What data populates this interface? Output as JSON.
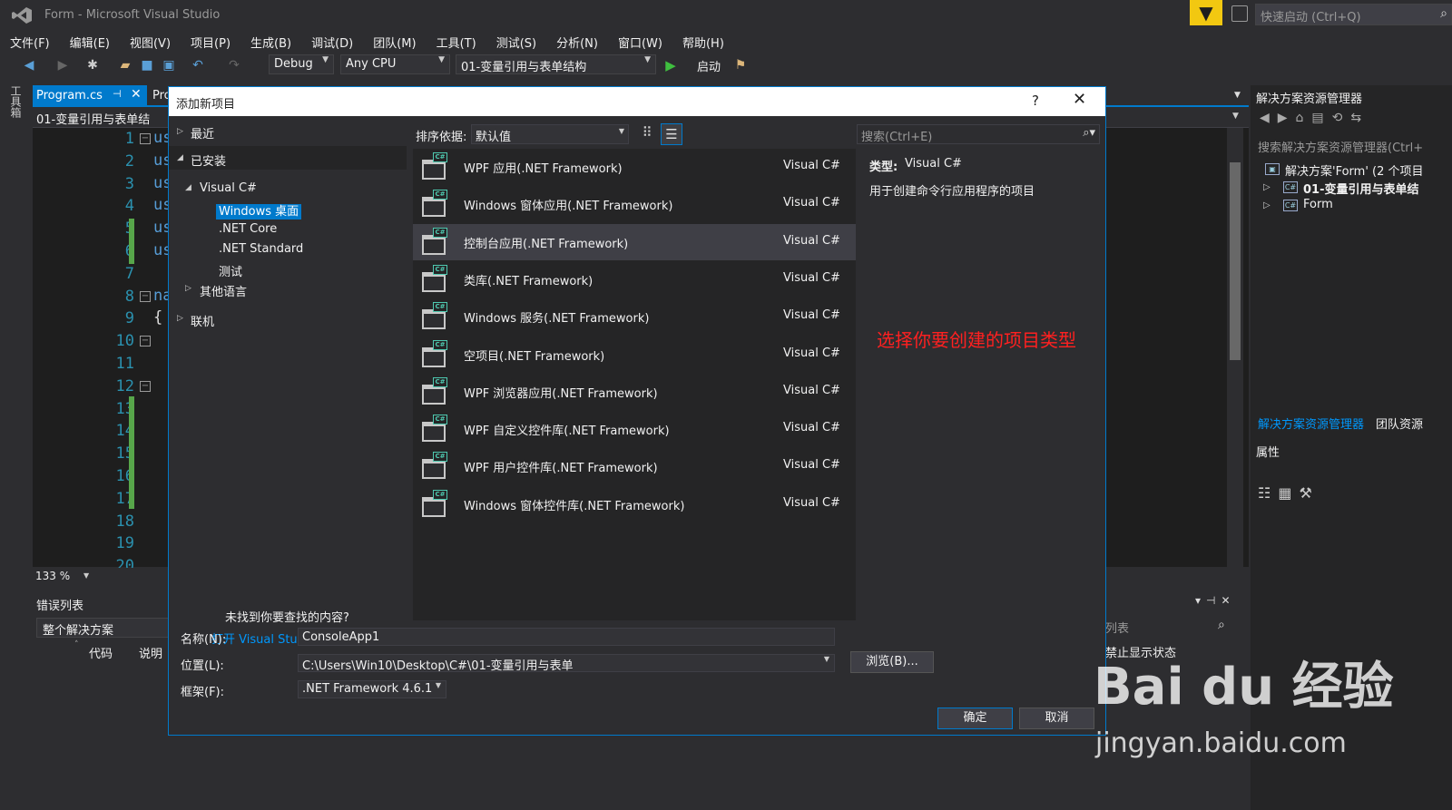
{
  "titlebar": {
    "title": "Form - Microsoft Visual Studio",
    "quick_launch_placeholder": "快速启动 (Ctrl+Q)"
  },
  "menu": [
    "文件(F)",
    "编辑(E)",
    "视图(V)",
    "项目(P)",
    "生成(B)",
    "调试(D)",
    "团队(M)",
    "工具(T)",
    "测试(S)",
    "分析(N)",
    "窗口(W)",
    "帮助(H)"
  ],
  "toolbar": {
    "config": "Debug",
    "platform": "Any CPU",
    "startup_project": "01-变量引用与表单结构",
    "start_label": "启动"
  },
  "toolbox_strip": "工具箱",
  "editor": {
    "tab_active": "Program.cs",
    "tab_second": "Pro",
    "nav_class": "01-变量引用与表单结",
    "line_numbers": [
      "1",
      "2",
      "3",
      "4",
      "5",
      "6",
      "7",
      "8",
      "9",
      "10",
      "11",
      "12",
      "13",
      "14",
      "15",
      "16",
      "17",
      "18",
      "19",
      "20"
    ],
    "code_fragments": {
      "us": "us",
      "na": "na",
      "brace": "{"
    },
    "zoom": "133 %"
  },
  "error_list": {
    "title": "错误列表",
    "scope": "整个解决方案",
    "col_code": "代码",
    "col_desc": "说明",
    "right_label": "列表",
    "suppress": "禁止显示状态"
  },
  "solution_explorer": {
    "title": "解决方案资源管理器",
    "search_placeholder": "搜索解决方案资源管理器(Ctrl+",
    "solution_node": "解决方案'Form' (2 个项目",
    "project1": "01-变量引用与表单结",
    "project2": "Form",
    "tab_explorer": "解决方案资源管理器",
    "tab_team": "团队资源",
    "properties_title": "属性"
  },
  "dialog": {
    "title": "添加新项目",
    "help": "?",
    "tree": {
      "recent": "最近",
      "installed": "已安装",
      "visual_cs": "Visual C#",
      "windows_desktop": "Windows 桌面",
      "net_core": ".NET Core",
      "net_standard": ".NET Standard",
      "test": "测试",
      "other_languages": "其他语言",
      "online": "联机"
    },
    "not_found": "未找到你要查找的内容?",
    "open_installer": "打开 Visual Studio 安装程序",
    "sort_label": "排序依据:",
    "sort_value": "默认值",
    "search_placeholder": "搜索(Ctrl+E)",
    "templates": [
      {
        "name": "WPF 应用(.NET Framework)",
        "lang": "Visual C#"
      },
      {
        "name": "Windows 窗体应用(.NET Framework)",
        "lang": "Visual C#"
      },
      {
        "name": "控制台应用(.NET Framework)",
        "lang": "Visual C#"
      },
      {
        "name": "类库(.NET Framework)",
        "lang": "Visual C#"
      },
      {
        "name": "Windows 服务(.NET Framework)",
        "lang": "Visual C#"
      },
      {
        "name": "空项目(.NET Framework)",
        "lang": "Visual C#"
      },
      {
        "name": "WPF 浏览器应用(.NET Framework)",
        "lang": "Visual C#"
      },
      {
        "name": "WPF 自定义控件库(.NET Framework)",
        "lang": "Visual C#"
      },
      {
        "name": "WPF 用户控件库(.NET Framework)",
        "lang": "Visual C#"
      },
      {
        "name": "Windows 窗体控件库(.NET Framework)",
        "lang": "Visual C#"
      }
    ],
    "description": {
      "type_label": "类型:",
      "type_value": "Visual C#",
      "text": "用于创建命令行应用程序的项目"
    },
    "annotation": "选择你要创建的项目类型",
    "form": {
      "name_label": "名称(N):",
      "name_value": "ConsoleApp1",
      "location_label": "位置(L):",
      "location_value": "C:\\Users\\Win10\\Desktop\\C#\\01-变量引用与表单",
      "framework_label": "框架(F):",
      "framework_value": ".NET Framework 4.6.1",
      "browse": "浏览(B)...",
      "ok": "确定",
      "cancel": "取消"
    }
  },
  "watermark": {
    "logo": "Bai du 经验",
    "url": "jingyan.baidu.com"
  },
  "colors": {
    "accent": "#007acc",
    "annotation": "#ff2020",
    "background": "#2d2d30",
    "editor": "#1e1e1e"
  }
}
